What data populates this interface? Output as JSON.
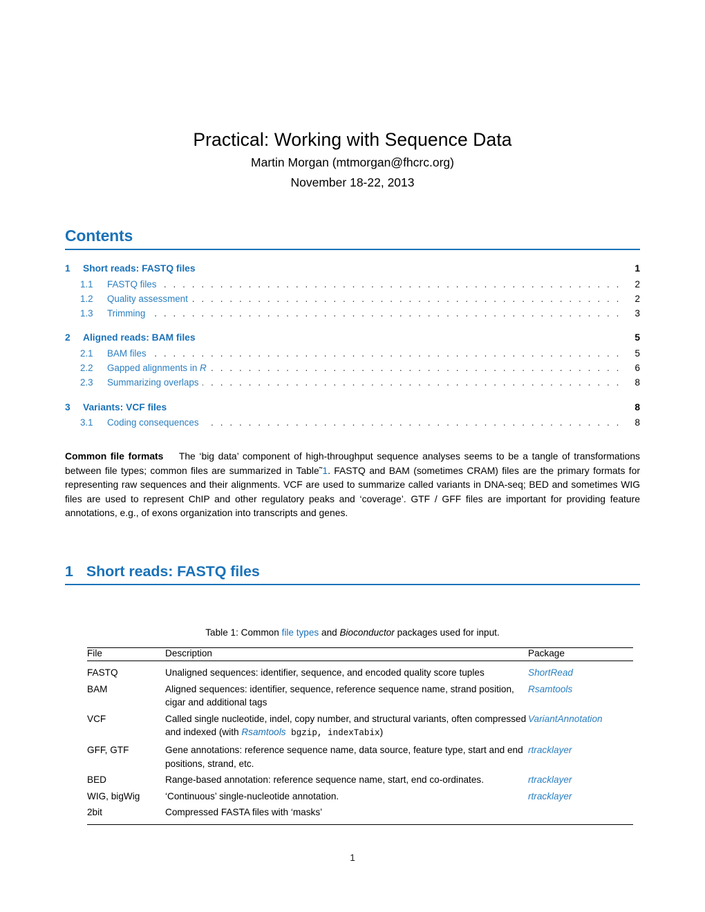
{
  "document": {
    "title": "Practical: Working with Sequence Data",
    "author": "Martin Morgan (mtmorgan@fhcrc.org)",
    "date": "November 18-22, 2013",
    "page_number": "1"
  },
  "colors": {
    "link_blue": "#1a72b8",
    "toc_sub_blue": "#2b7fc0",
    "text_black": "#000000"
  },
  "contents": {
    "heading": "Contents",
    "entries": [
      {
        "level": "section",
        "number": "1",
        "label": "Short reads: FASTQ files",
        "page": "1"
      },
      {
        "level": "subsection",
        "number": "1.1",
        "label": "FASTQ files",
        "page": "2"
      },
      {
        "level": "subsection",
        "number": "1.2",
        "label": "Quality assessment",
        "page": "2"
      },
      {
        "level": "subsection",
        "number": "1.3",
        "label": "Trimming",
        "page": "3"
      },
      {
        "level": "section",
        "number": "2",
        "label": "Aligned reads: BAM files",
        "page": "5"
      },
      {
        "level": "subsection",
        "number": "2.1",
        "label": "BAM files",
        "page": "5"
      },
      {
        "level": "subsection",
        "number": "2.2",
        "label": "Gapped alignments in R",
        "page": "6"
      },
      {
        "level": "subsection",
        "number": "2.3",
        "label": "Summarizing overlaps",
        "page": "8"
      },
      {
        "level": "section",
        "number": "3",
        "label": "Variants: VCF files",
        "page": "8"
      },
      {
        "level": "subsection",
        "number": "3.1",
        "label": "Coding consequences",
        "page": "8"
      }
    ]
  },
  "paragraph": {
    "lead_in": "Common file formats",
    "text_part_1": "The ‘big data’ component of high-throughput sequence analyses seems to be a tangle of transformations between file types; common files are summarized in Table˜",
    "table_ref": "1",
    "text_part_2": ". FASTQ and BAM (sometimes CRAM) files are the primary formats for representing raw sequences and their alignments. VCF are used to summarize called variants in DNA-seq; BED and sometimes WIG files are used to represent ChIP and other regulatory peaks and ‘coverage’. GTF / GFF files are important for providing feature annotations, e.g., of exons organization into transcripts and genes."
  },
  "section1": {
    "number": "1",
    "title": "Short reads: FASTQ files"
  },
  "table": {
    "caption_prefix": "Table 1: Common ",
    "caption_link": "file types",
    "caption_middle": " and ",
    "caption_italic": "Bioconductor",
    "caption_suffix": " packages used for input.",
    "headers": [
      "File",
      "Description",
      "Package"
    ],
    "rows": [
      {
        "file": "FASTQ",
        "description": "Unaligned sequences: identifier, sequence, and encoded quality score tuples",
        "package": "ShortRead"
      },
      {
        "file": "BAM",
        "description": "Aligned sequences: identifier, sequence, reference sequence name, strand position, cigar and additional tags",
        "package": "Rsamtools"
      },
      {
        "file": "VCF",
        "description_part_1": "Called single nucleotide, indel, copy number, and structural variants, often compressed and indexed (with ",
        "description_italic": "Rsamtools",
        "description_mono": " bgzip, indexTabix",
        "description_part_2": ")",
        "package": "VariantAnnotation"
      },
      {
        "file": "GFF, GTF",
        "description": "Gene annotations: reference sequence name, data source, feature type, start and end positions, strand, etc.",
        "package": "rtracklayer"
      },
      {
        "file": "BED",
        "description": "Range-based annotation: reference sequence name, start, end co-ordinates.",
        "package": "rtracklayer"
      },
      {
        "file": "WIG, bigWig",
        "description": "‘Continuous’ single-nucleotide annotation.",
        "package": "rtracklayer"
      },
      {
        "file": "2bit",
        "description": "Compressed FASTA files with ‘masks’",
        "package": ""
      }
    ]
  }
}
